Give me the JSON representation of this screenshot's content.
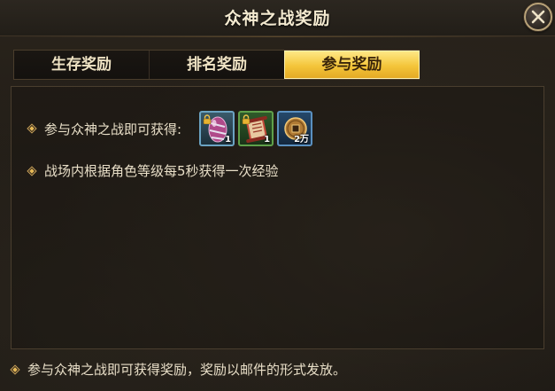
{
  "window": {
    "title": "众神之战奖励"
  },
  "tabs": [
    {
      "label": "生存奖励",
      "active": false
    },
    {
      "label": "排名奖励",
      "active": false
    },
    {
      "label": "参与奖励",
      "active": true
    }
  ],
  "panel": {
    "line1": "参与众神之战即可获得:",
    "line2": "战场内根据角色等级每5秒获得一次经验",
    "rewards": [
      {
        "icon": "purple-egg-icon",
        "count": "1",
        "locked": true,
        "frame": "#6ba3c2"
      },
      {
        "icon": "red-scroll-icon",
        "count": "1",
        "locked": true,
        "frame": "#5fa04a"
      },
      {
        "icon": "copper-coin-icon",
        "count": "2万",
        "locked": false,
        "frame": "#5a90c0"
      }
    ]
  },
  "footer": {
    "note": "参与众神之战即可获得奖励，奖励以邮件的形式发放。"
  },
  "colors": {
    "accent_gold": "#f4c53a",
    "text": "#e9dfc8",
    "title_text": "#f4ead0"
  }
}
